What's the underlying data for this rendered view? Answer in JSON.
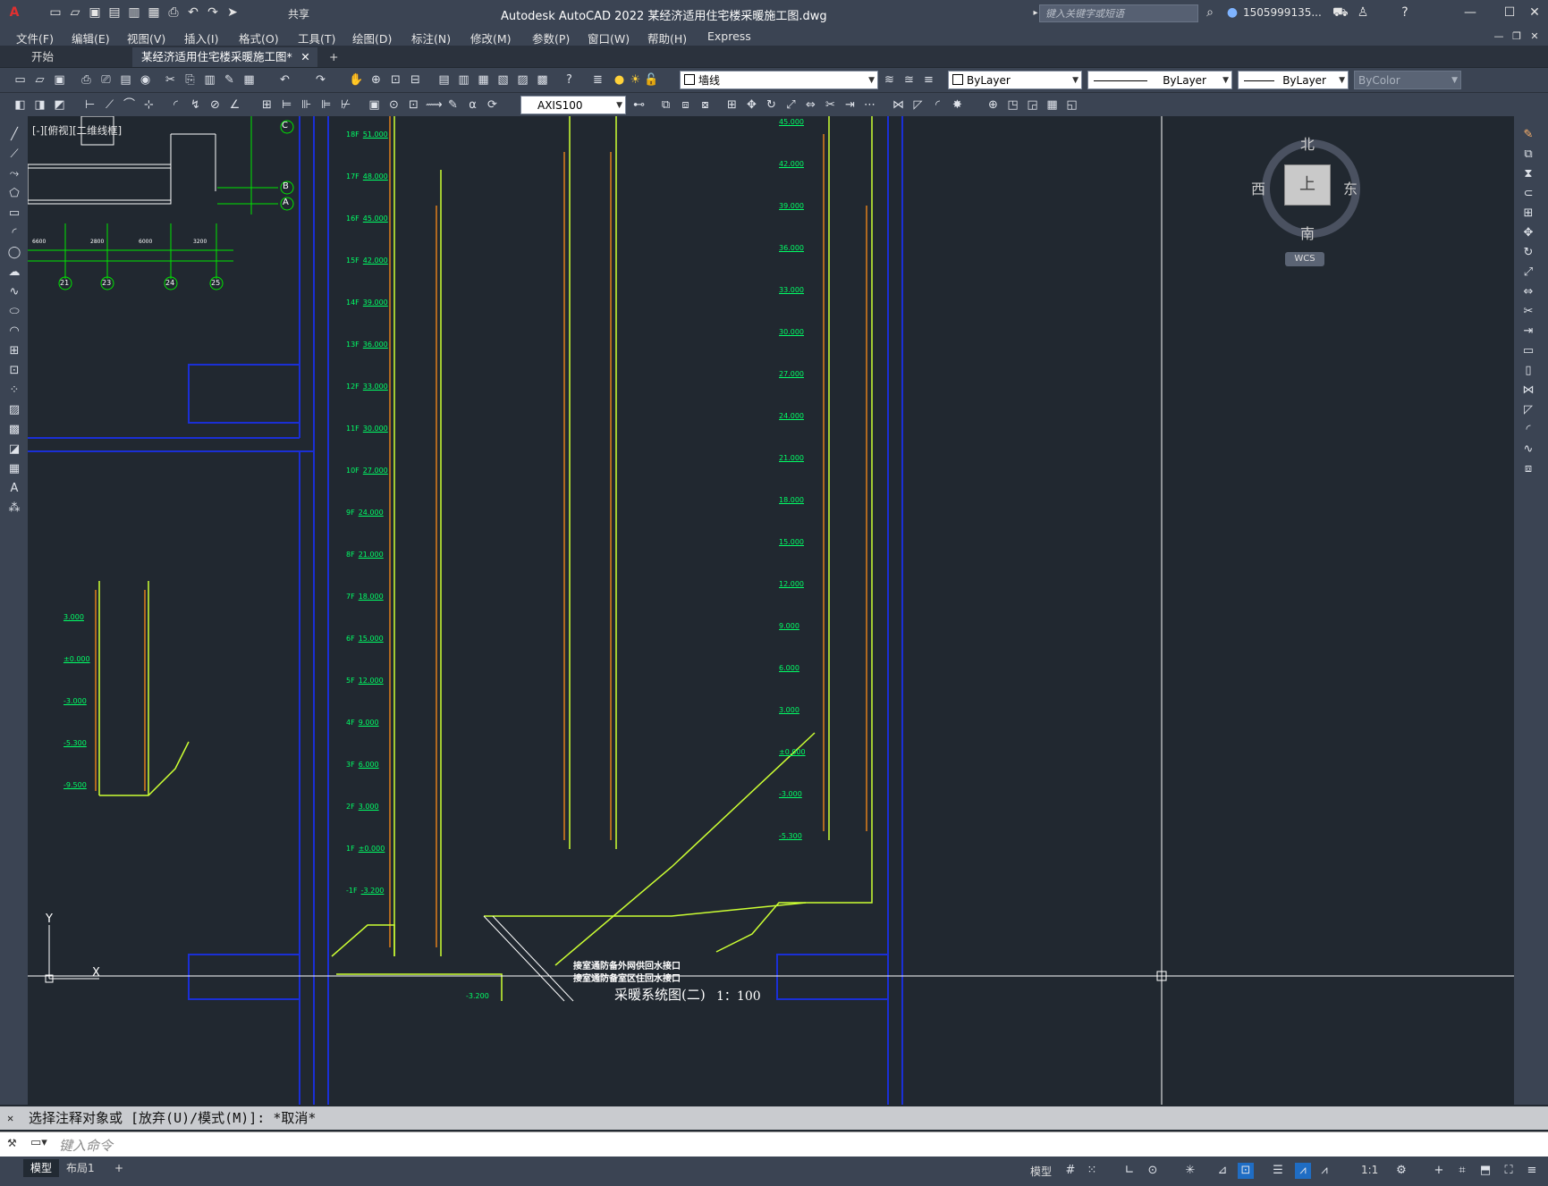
{
  "app": {
    "title": "Autodesk AutoCAD 2022    某经济适用住宅楼采暖施工图.dwg",
    "share": "共享",
    "search_placeholder": "键入关键字或短语",
    "user": "1505999135..."
  },
  "menu": [
    "文件(F)",
    "编辑(E)",
    "视图(V)",
    "插入(I)",
    "格式(O)",
    "工具(T)",
    "绘图(D)",
    "标注(N)",
    "修改(M)",
    "参数(P)",
    "窗口(W)",
    "帮助(H)",
    "Express"
  ],
  "tabs": {
    "start": "开始",
    "file": "某经济适用住宅楼采暖施工图*",
    "add": "+"
  },
  "toolbar1": {
    "layer": "墙线",
    "color": "ByLayer",
    "linetype": "ByLayer",
    "lineweight": "ByLayer",
    "plotstyle": "ByColor"
  },
  "toolbar2": {
    "dimstyle": "AXIS100"
  },
  "view_label": "[-][俯视][二维线框]",
  "viewcube": {
    "north": "北",
    "south": "南",
    "east": "东",
    "west": "西",
    "top": "上",
    "wcs": "WCS"
  },
  "drawing": {
    "title": "采暖系统图(二)",
    "scale": "1：100",
    "axis_labels": [
      "C",
      "B",
      "A",
      "21",
      "23",
      "24",
      "25"
    ],
    "dim_labels": [
      "6600",
      "2800",
      "6000",
      "3200"
    ],
    "floors_left": [
      "18F",
      "17F",
      "16F",
      "15F",
      "14F",
      "13F",
      "12F",
      "11F",
      "10F",
      "9F",
      "8F",
      "7F",
      "6F",
      "5F",
      "4F",
      "3F",
      "2F",
      "1F",
      "-1F"
    ],
    "elevations_left": [
      "51.000",
      "48.000",
      "45.000",
      "42.000",
      "39.000",
      "36.000",
      "33.000",
      "30.000",
      "27.000",
      "24.000",
      "21.000",
      "18.000",
      "15.000",
      "12.000",
      "9.000",
      "6.000",
      "3.000",
      "±0.000",
      "-3.200"
    ],
    "elevations_right": [
      "45.000",
      "42.000",
      "39.000",
      "36.000",
      "33.000",
      "30.000",
      "27.000",
      "24.000",
      "21.000",
      "18.000",
      "15.000",
      "12.000",
      "9.000",
      "6.000",
      "3.000",
      "±0.000",
      "-3.000",
      "-5.300"
    ],
    "elevations_small": [
      "3.000",
      "±0.000",
      "-3.000",
      "-5.300",
      "-9.500"
    ],
    "note1": "接室通防备外网供回水接口",
    "note2": "接室通防备室区住回水接口",
    "label_bottom": "-3.200"
  },
  "command": {
    "history": "选择注释对象或 [放弃(U)/模式(M)]: *取消*",
    "placeholder": "键入命令"
  },
  "status": {
    "model_tab": "模型",
    "layout_tab": "布局1",
    "add": "+",
    "model_btn": "模型",
    "scale": "1:1"
  }
}
